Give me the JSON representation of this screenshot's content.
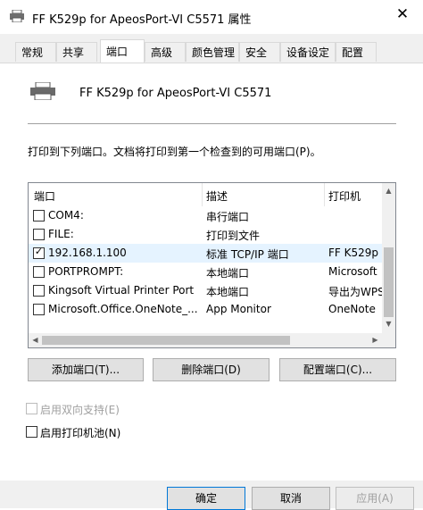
{
  "window": {
    "title": "FF K529p for ApeosPort-VI C5571 属性",
    "close_glyph": "✕"
  },
  "tabs": [
    {
      "label": "常规"
    },
    {
      "label": "共享"
    },
    {
      "label": "端口"
    },
    {
      "label": "高级"
    },
    {
      "label": "颜色管理"
    },
    {
      "label": "安全"
    },
    {
      "label": "设备设定"
    },
    {
      "label": "配置"
    }
  ],
  "printer": {
    "name": "FF K529p for ApeosPort-VI C5571"
  },
  "description": "打印到下列端口。文档将打印到第一个检查到的可用端口(P)。",
  "port_table": {
    "headers": [
      "端口",
      "描述",
      "打印机"
    ],
    "rows": [
      {
        "port": "COM4:",
        "desc": "串行端口",
        "printer": "",
        "checked": false,
        "selected": false
      },
      {
        "port": "FILE:",
        "desc": "打印到文件",
        "printer": "",
        "checked": false,
        "selected": false
      },
      {
        "port": "192.168.1.100",
        "desc": "标准 TCP/IP 端口",
        "printer": "FF K529p",
        "checked": true,
        "selected": true
      },
      {
        "port": "PORTPROMPT:",
        "desc": "本地端口",
        "printer": "Microsoft",
        "checked": false,
        "selected": false
      },
      {
        "port": "Kingsoft Virtual Printer Port",
        "desc": "本地端口",
        "printer": "导出为WPS",
        "checked": false,
        "selected": false
      },
      {
        "port": "Microsoft.Office.OneNote_...",
        "desc": "App Monitor",
        "printer": "OneNote",
        "checked": false,
        "selected": false
      }
    ]
  },
  "buttons": {
    "add_port": "添加端口(T)...",
    "delete_port": "删除端口(D)",
    "configure_port": "配置端口(C)..."
  },
  "options": {
    "bidirectional": "启用双向支持(E)",
    "pooling": "启用打印机池(N)"
  },
  "dialog_buttons": {
    "ok": "确定",
    "cancel": "取消",
    "apply": "应用(A)"
  },
  "check_glyph": "✓"
}
